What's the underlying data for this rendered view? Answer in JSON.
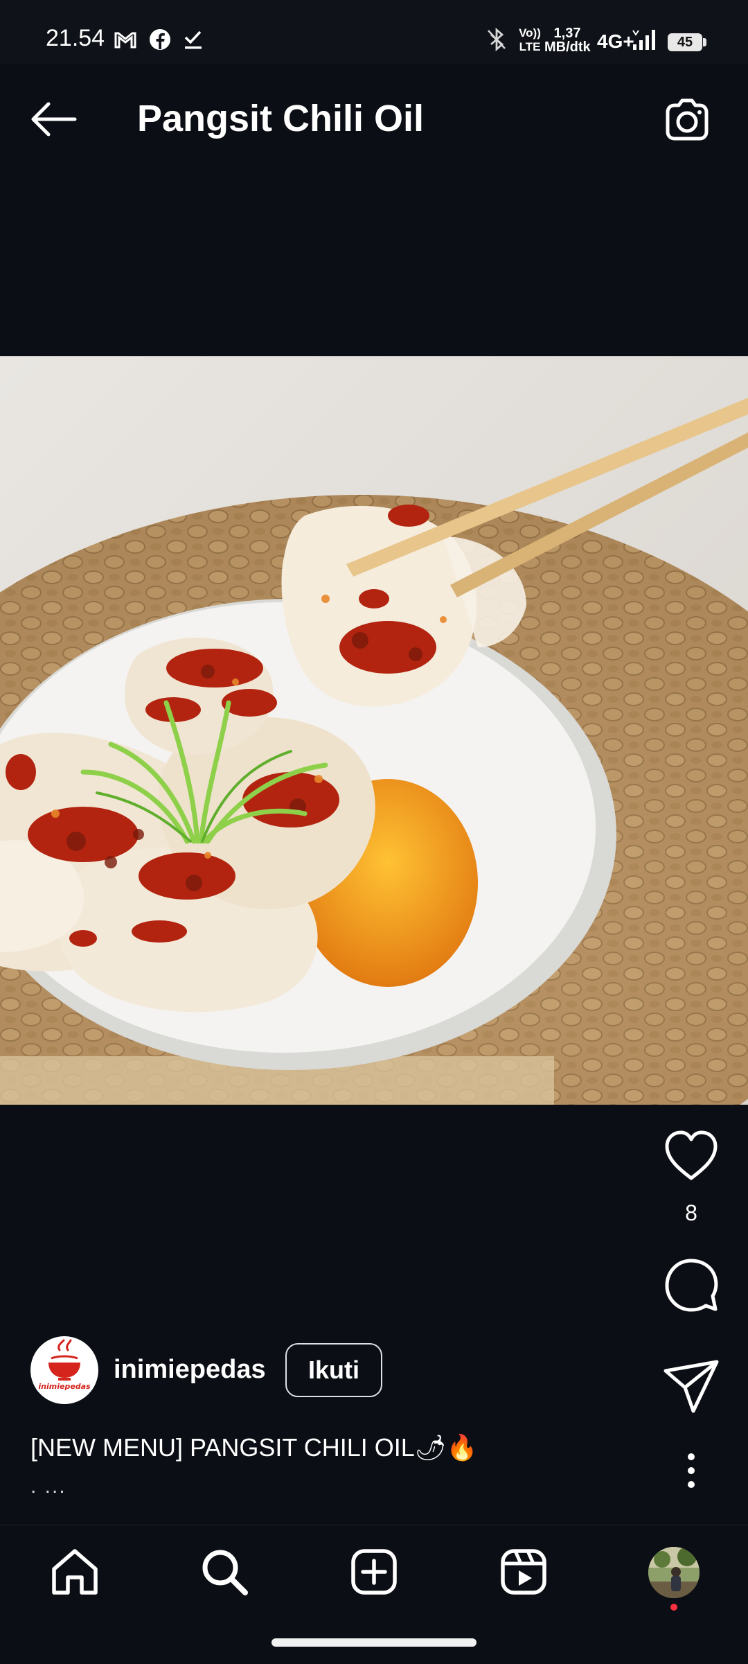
{
  "status_bar": {
    "time": "21.54",
    "net_speed_value": "1,37",
    "net_speed_unit": "MB/dtk",
    "volte_top": "Vo))",
    "volte_bottom": "LTE",
    "network": "4G+",
    "battery": "45",
    "icons": [
      "gmail-icon",
      "facebook-icon",
      "check-download-icon",
      "bluetooth-icon",
      "volte-icon",
      "signal-icon",
      "battery-icon"
    ]
  },
  "header": {
    "title": "Pangsit Chili Oil",
    "back_icon": "back-arrow-icon",
    "camera_icon": "camera-icon"
  },
  "post": {
    "image_alt": "Pangsit chili oil",
    "likes": "8",
    "author": {
      "username": "inimiepedas",
      "follow_label": "Ikuti",
      "logo_text": "inimiepedas"
    },
    "caption": "[NEW MENU] PANGSIT CHILI OIL🌶🔥",
    "caption_more": ". ...",
    "actions": [
      "heart-icon",
      "comment-icon",
      "share-icon",
      "more-icon"
    ]
  },
  "bottom_nav": {
    "items": [
      "home",
      "search",
      "create",
      "reels",
      "profile"
    ]
  },
  "colors": {
    "background": "#0b0e14",
    "notification_dot": "#ff3040"
  }
}
